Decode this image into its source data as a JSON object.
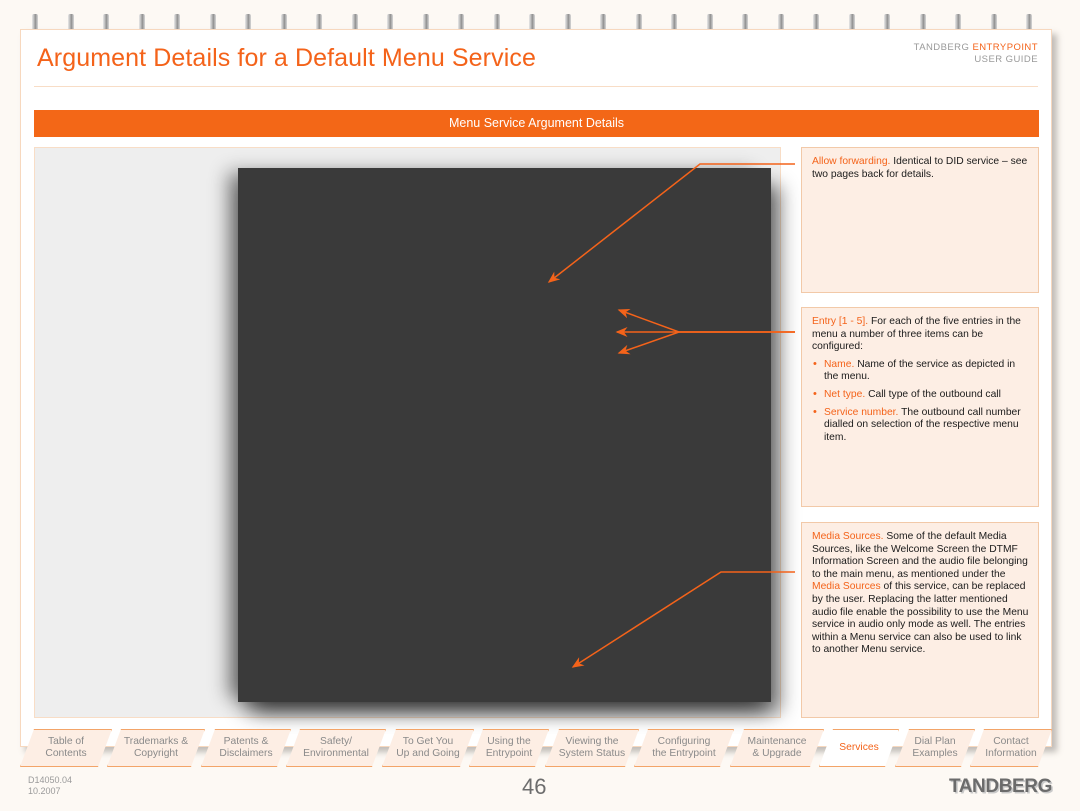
{
  "header": {
    "title": "Argument Details for a Default Menu Service",
    "brand_line1_prefix": "TANDBERG ",
    "brand_line1_accent": "ENTRYPOINT",
    "brand_line2": "USER GUIDE"
  },
  "banner": {
    "label": "Menu Service Argument Details"
  },
  "callouts": [
    {
      "term": "Allow forwarding.",
      "body": " Identical to DID service – see two pages back for details."
    },
    {
      "term": "Entry [1 - 5].",
      "body": " For each of the five entries in the menu a number of three items can be configured:",
      "items": [
        {
          "term": "Name.",
          "body": " Name of the service as depicted in the menu."
        },
        {
          "term": "Net type.",
          "body": " Call type of the outbound call"
        },
        {
          "term": "Service number.",
          "body": " The outbound call number dialled on selection of the respective menu item."
        }
      ]
    },
    {
      "term": "Media Sources.",
      "body_part1": " Some of the default Media Sources, like the Welcome Screen the DTMF Information Screen and the audio file belonging to the main menu, as mentioned under the ",
      "inline_term": "Media Sources",
      "body_part2": " of this service, can be replaced by the user. Replacing the latter mentioned audio file enable the possibility to use the Menu service in audio only mode as well. The entries within a Menu service can also be used to link to another Menu service."
    }
  ],
  "tabs": [
    {
      "line1": "Table of",
      "line2": "Contents",
      "active": false
    },
    {
      "line1": "Trademarks &",
      "line2": "Copyright",
      "active": false
    },
    {
      "line1": "Patents &",
      "line2": "Disclaimers",
      "active": false
    },
    {
      "line1": "Safety/",
      "line2": "Environmental",
      "active": false
    },
    {
      "line1": "To Get You",
      "line2": "Up and Going",
      "active": false
    },
    {
      "line1": "Using the",
      "line2": "Entrypoint",
      "active": false
    },
    {
      "line1": "Viewing the",
      "line2": "System Status",
      "active": false
    },
    {
      "line1": "Configuring",
      "line2": "the Entrypoint",
      "active": false
    },
    {
      "line1": "Maintenance",
      "line2": "& Upgrade",
      "active": false
    },
    {
      "line1": "Services",
      "line2": "",
      "active": true
    },
    {
      "line1": "Dial Plan",
      "line2": "Examples",
      "active": false
    },
    {
      "line1": "Contact",
      "line2": "Information",
      "active": false
    }
  ],
  "footer": {
    "doc_number": "D14050.04",
    "doc_date": "10.2007",
    "page_number": "46",
    "logo": "TANDBERG"
  },
  "colors": {
    "accent_orange": "#f4631a",
    "banner_orange": "#f36717",
    "callout_bg": "#fdeee4",
    "callout_border": "#f2c9a8",
    "panel_gray": "#eeeeee",
    "screenshot_dark": "#3a3a3a"
  }
}
